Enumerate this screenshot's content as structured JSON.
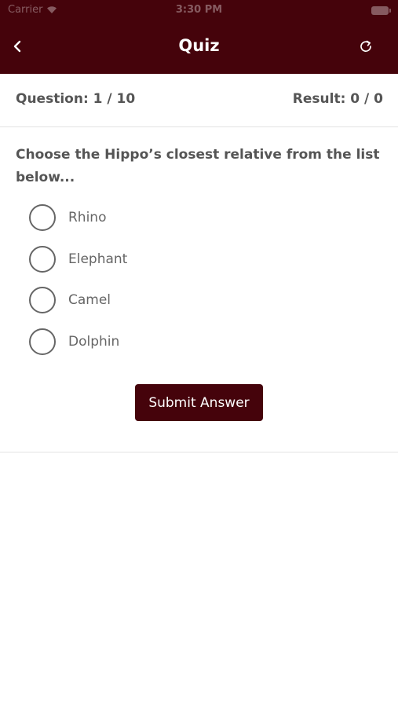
{
  "status_bar": {
    "carrier": "Carrier",
    "time": "3:30 PM"
  },
  "nav": {
    "title": "Quiz",
    "back_icon": "chevron-left-icon",
    "refresh_icon": "refresh-icon"
  },
  "progress": {
    "question": "Question: 1 / 10",
    "result": "Result: 0 / 0"
  },
  "question": {
    "text": "Choose the Hippo’s closest relative from the list below...",
    "options": [
      {
        "label": "Rhino",
        "selected": false
      },
      {
        "label": "Elephant",
        "selected": false
      },
      {
        "label": "Camel",
        "selected": false
      },
      {
        "label": "Dolphin",
        "selected": false
      }
    ]
  },
  "submit_label": "Submit Answer",
  "colors": {
    "primary": "#45030b",
    "text": "#555555",
    "option_text": "#666666"
  }
}
